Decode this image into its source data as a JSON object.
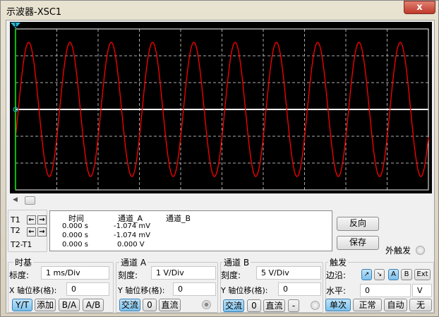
{
  "window": {
    "title": "示波器-XSC1",
    "close_label": "x"
  },
  "waveform": {
    "channel": "A",
    "color": "#ff0000",
    "period_ms": 1,
    "amplitude_v": 2.5,
    "trace_color": "#ffffff",
    "cursor_color": "#00ff00",
    "cursor_marker": "1"
  },
  "cursors": {
    "t1": "T1",
    "t2": "T2",
    "diff": "T2-T1"
  },
  "readout": {
    "headers": [
      "时间",
      "通道_A",
      "通道_B"
    ],
    "rows": [
      [
        "0.000 s",
        "-1.074 mV",
        ""
      ],
      [
        "0.000 s",
        "-1.074 mV",
        ""
      ],
      [
        "0.000 s",
        "0.000 V",
        ""
      ]
    ]
  },
  "buttons": {
    "reverse": "反向",
    "save": "保存",
    "ext_trigger": "外触发"
  },
  "timebase": {
    "title": "时基",
    "scale_label": "标度:",
    "scale": "1 ms/Div",
    "xpos_label": "X 轴位移(格):",
    "xpos": "0",
    "modes": [
      "Y/T",
      "添加",
      "B/A",
      "A/B"
    ]
  },
  "chA": {
    "title": "通道 A",
    "scale_label": "刻度:",
    "scale": "1  V/Div",
    "ypos_label": "Y 轴位移(格):",
    "ypos": "0",
    "coupling": [
      "交流",
      "0",
      "直流"
    ]
  },
  "chB": {
    "title": "通道 B",
    "scale_label": "刻度:",
    "scale": "5  V/Div",
    "ypos_label": "Y 轴位移(格):",
    "ypos": "0",
    "coupling": [
      "交流",
      "0",
      "直流",
      "-"
    ]
  },
  "trigger": {
    "title": "触发",
    "edge_label": "边沿:",
    "edges": [
      "↗",
      "↘"
    ],
    "sources": [
      "A",
      "B",
      "Ext"
    ],
    "level_label": "水平:",
    "level": "0",
    "level_unit": "V",
    "modes": [
      "单次",
      "正常",
      "自动",
      "无"
    ]
  }
}
